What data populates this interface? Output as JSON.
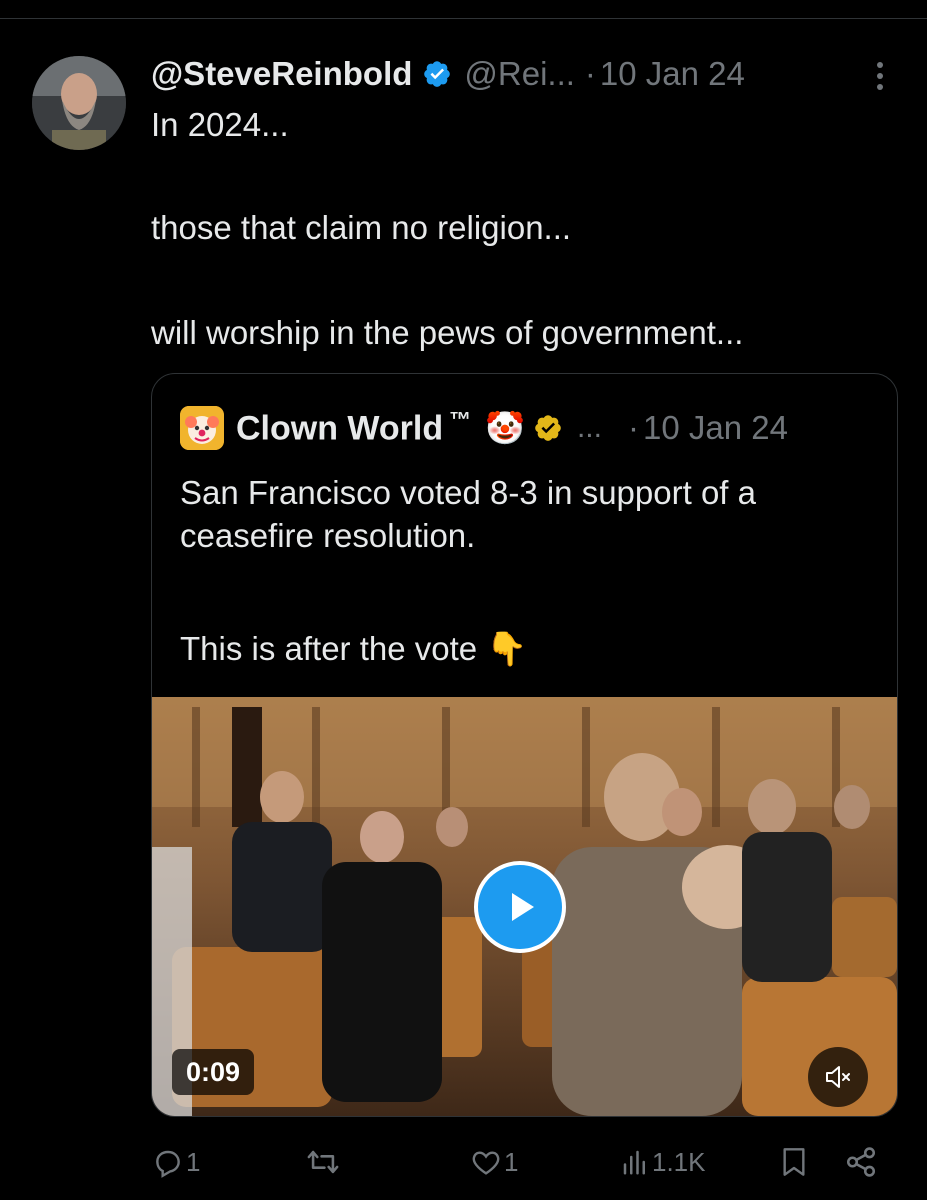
{
  "tweet": {
    "display_name": "@SteveReinbold",
    "handle": "@Rei...",
    "separator": "·",
    "date": "10 Jan 24",
    "text_lines": [
      "In 2024...",
      "those that claim no religion...",
      "will worship in the pews of government..."
    ]
  },
  "quote": {
    "display_name": "Clown World",
    "trademark": "™",
    "name_emoji": "🤡",
    "ellipsis": "...",
    "separator": "·",
    "date": "10 Jan 24",
    "text_line1": "San Francisco voted 8-3 in support of a ceasefire resolution.",
    "text_line2": "This is after the vote",
    "pointing_emoji": "👇",
    "video": {
      "duration": "0:09"
    }
  },
  "actions": {
    "replies": "1",
    "reposts": "",
    "likes": "1",
    "views": "1.1K"
  },
  "colors": {
    "accent": "#1d9bf0",
    "muted": "#71767b",
    "background": "#000000",
    "text": "#e7e9ea",
    "border": "#2f3336"
  },
  "icons": [
    "more-icon",
    "verified-icon",
    "play-icon",
    "mute-icon",
    "reply-icon",
    "repost-icon",
    "like-icon",
    "views-icon",
    "bookmark-icon",
    "share-icon"
  ]
}
